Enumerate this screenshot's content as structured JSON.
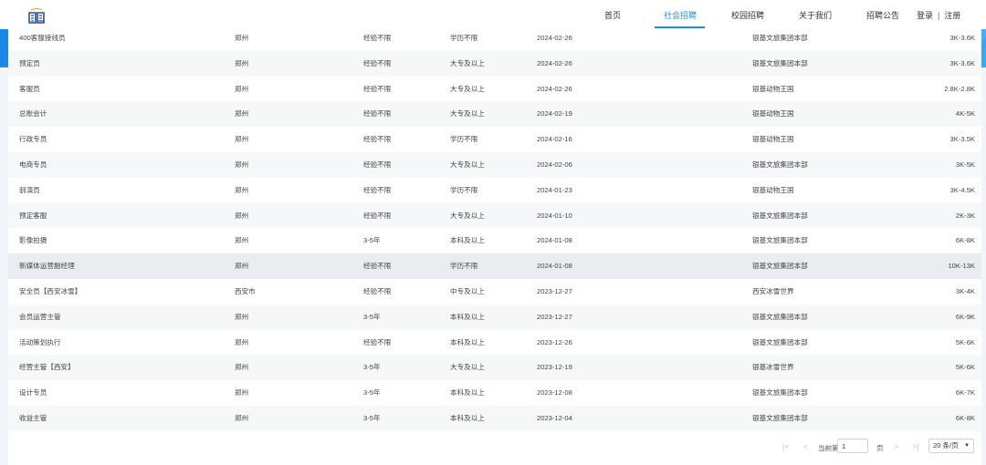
{
  "header": {
    "nav": [
      {
        "label": "首页",
        "active": false
      },
      {
        "label": "社会招聘",
        "active": true
      },
      {
        "label": "校园招聘",
        "active": false
      },
      {
        "label": "关于我们",
        "active": false
      },
      {
        "label": "招聘公告",
        "active": false
      }
    ],
    "login": "登录",
    "separator": "|",
    "register": "注册"
  },
  "colors": {
    "accent": "#1d8ee8",
    "band": "#2a97ec",
    "hover_row": "#e9ecf0"
  },
  "jobs": [
    {
      "title": "400客服接线员",
      "city": "郑州",
      "experience": "经验不限",
      "education": "学历不限",
      "date": "2024-02-26",
      "company": "银基文旅集团本部",
      "salary": "3K-3.6K"
    },
    {
      "title": "预定员",
      "city": "郑州",
      "experience": "经验不限",
      "education": "大专及以上",
      "date": "2024-02-26",
      "company": "银基文旅集团本部",
      "salary": "3K-3.6K"
    },
    {
      "title": "客服员",
      "city": "郑州",
      "experience": "经验不限",
      "education": "大专及以上",
      "date": "2024-02-26",
      "company": "银基动物王国",
      "salary": "2.8K-2.8K"
    },
    {
      "title": "总账会计",
      "city": "郑州",
      "experience": "经验不限",
      "education": "大专及以上",
      "date": "2024-02-19",
      "company": "银基动物王国",
      "salary": "4K-5K"
    },
    {
      "title": "行政专员",
      "city": "郑州",
      "experience": "经验不限",
      "education": "学历不限",
      "date": "2024-02-16",
      "company": "银基动物王国",
      "salary": "3K-3.5K"
    },
    {
      "title": "电商专员",
      "city": "郑州",
      "experience": "经验不限",
      "education": "大专及以上",
      "date": "2024-02-06",
      "company": "银基文旅集团本部",
      "salary": "3K-5K"
    },
    {
      "title": "驯演员",
      "city": "郑州",
      "experience": "经验不限",
      "education": "学历不限",
      "date": "2024-01-23",
      "company": "银基动物王国",
      "salary": "3K-4.5K"
    },
    {
      "title": "预定客服",
      "city": "郑州",
      "experience": "经验不限",
      "education": "大专及以上",
      "date": "2024-01-10",
      "company": "银基文旅集团本部",
      "salary": "2K-3K"
    },
    {
      "title": "影像拍摄",
      "city": "郑州",
      "experience": "3-5年",
      "education": "本科及以上",
      "date": "2024-01-08",
      "company": "银基文旅集团本部",
      "salary": "6K-8K"
    },
    {
      "title": "新媒体运营副经理",
      "city": "郑州",
      "experience": "经验不限",
      "education": "学历不限",
      "date": "2024-01-08",
      "company": "银基文旅集团本部",
      "salary": "10K-13K"
    },
    {
      "title": "安全员【西安冰雪】",
      "city": "西安市",
      "experience": "经验不限",
      "education": "中专及以上",
      "date": "2023-12-27",
      "company": "西安冰雪世界",
      "salary": "3K-4K"
    },
    {
      "title": "会员运营主管",
      "city": "郑州",
      "experience": "3-5年",
      "education": "本科及以上",
      "date": "2023-12-27",
      "company": "银基文旅集团本部",
      "salary": "6K-9K"
    },
    {
      "title": "活动策划执行",
      "city": "郑州",
      "experience": "经验不限",
      "education": "本科及以上",
      "date": "2023-12-26",
      "company": "银基文旅集团本部",
      "salary": "5K-6K"
    },
    {
      "title": "经营主管【西安】",
      "city": "郑州",
      "experience": "3-5年",
      "education": "大专及以上",
      "date": "2023-12-19",
      "company": "银基冰雪世界",
      "salary": "5K-6K"
    },
    {
      "title": "设计专员",
      "city": "郑州",
      "experience": "3-5年",
      "education": "本科及以上",
      "date": "2023-12-08",
      "company": "银基文旅集团本部",
      "salary": "6K-7K"
    },
    {
      "title": "收益主管",
      "city": "郑州",
      "experience": "3-5年",
      "education": "本科及以上",
      "date": "2023-12-04",
      "company": "银基文旅集团本部",
      "salary": "6K-8K"
    }
  ],
  "pagination": {
    "current_label": "当前第",
    "current_page": "1",
    "page_suffix": "页",
    "page_size": "20 条/页",
    "first_icon": "first-page-icon",
    "prev_icon": "prev-page-icon",
    "next_icon": "next-page-icon",
    "last_icon": "last-page-icon"
  }
}
